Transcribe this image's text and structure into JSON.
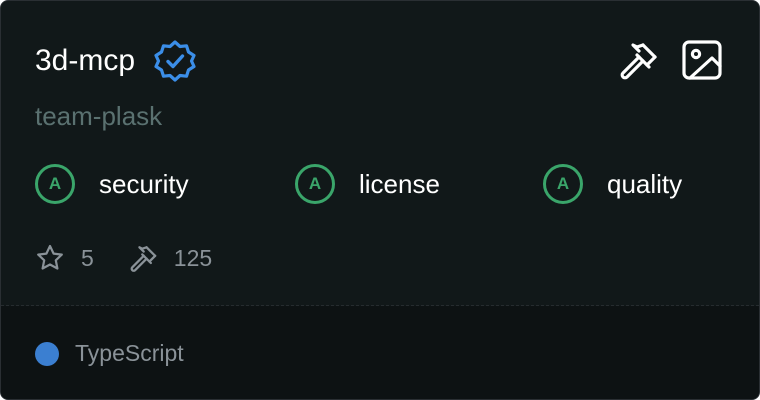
{
  "server": {
    "name": "3d-mcp",
    "org": "team-plask",
    "verified_icon": "verified-badge-icon"
  },
  "actions": [
    {
      "icon": "hammer-icon"
    },
    {
      "icon": "image-icon"
    }
  ],
  "grades": [
    {
      "grade": "A",
      "label": "security"
    },
    {
      "grade": "A",
      "label": "license"
    },
    {
      "grade": "A",
      "label": "quality"
    }
  ],
  "stats": {
    "stars": "5",
    "tools": "125"
  },
  "language": {
    "name": "TypeScript",
    "color": "#3b7fd1"
  },
  "colors": {
    "background": "#111819",
    "grade_green": "#3aa56a",
    "verified_blue": "#3b8ee8"
  }
}
